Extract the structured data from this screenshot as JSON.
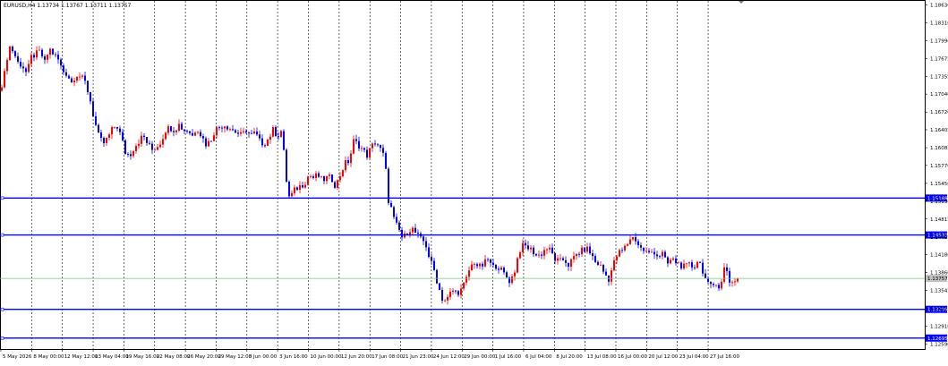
{
  "header": {
    "symbol_line": "EURUSD,H4  1.13734 1.13767 1.13711 1.13757"
  },
  "colors": {
    "background": "#ffffff",
    "bull": "#ff0000",
    "bear": "#0000ff",
    "grid": "#000000",
    "hline": "#0000ff",
    "current_price_line": "#7fbf7f"
  },
  "chart_data": {
    "type": "candlestick",
    "title": "EURUSD,H4",
    "ohlc_header": {
      "open": 1.13734,
      "high": 1.13767,
      "low": 1.13711,
      "close": 1.13757
    },
    "ylim": [
      1.125,
      1.187
    ],
    "grid": "vertical dashed",
    "price_ticks": [
      "1.18630",
      "1.18310",
      "1.17990",
      "1.17675",
      "1.17355",
      "1.17040",
      "1.16720",
      "1.16405",
      "1.16085",
      "1.15770",
      "1.15450",
      "1.15130",
      "1.14815",
      "1.14495",
      "1.14180",
      "1.13860",
      "1.13545",
      "1.13225",
      "1.12910",
      "1.12590"
    ],
    "time_labels": [
      "5 May 2026",
      "8 May 00:00",
      "12 May 12:00",
      "13 May 04:00",
      "19 May 16:00",
      "22 May 08:00",
      "26 May 20:00",
      "29 May 12:00",
      "3 Jun 00:00",
      "3 Jun 16:00",
      "10 Jun 00:00",
      "12 Jun 20:00",
      "17 Jun 08:00",
      "21 Jun 23:00",
      "24 Jun 12:00",
      "29 Jun 00:00",
      "1 Jul 16:00",
      "6 Jul 04:00",
      "8 Jul 20:00",
      "13 Jul 08:00",
      "16 Jul 00:00",
      "20 Jul 12:00",
      "23 Jul 04:00",
      "27 Jul 16:00"
    ],
    "horizontal_lines": [
      {
        "label": "1.15188",
        "price": 1.15188
      },
      {
        "label": "1.14531",
        "price": 1.14531
      },
      {
        "label": "1.13206",
        "price": 1.13206
      },
      {
        "label": "1.12695",
        "price": 1.12695
      }
    ],
    "current_price": {
      "label": "1.13757",
      "price": 1.13757
    },
    "close_path": [
      [
        0,
        1.171
      ],
      [
        5,
        1.174
      ],
      [
        10,
        1.179
      ],
      [
        15,
        1.178
      ],
      [
        20,
        1.176
      ],
      [
        25,
        1.1755
      ],
      [
        30,
        1.174
      ],
      [
        35,
        1.177
      ],
      [
        40,
        1.1775
      ],
      [
        45,
        1.178
      ],
      [
        50,
        1.176
      ],
      [
        55,
        1.1785
      ],
      [
        60,
        1.1775
      ],
      [
        65,
        1.1765
      ],
      [
        70,
        1.1745
      ],
      [
        75,
        1.174
      ],
      [
        80,
        1.1725
      ],
      [
        85,
        1.174
      ],
      [
        90,
        1.1735
      ],
      [
        95,
        1.1725
      ],
      [
        100,
        1.17
      ],
      [
        105,
        1.166
      ],
      [
        110,
        1.163
      ],
      [
        115,
        1.1615
      ],
      [
        120,
        1.1625
      ],
      [
        125,
        1.164
      ],
      [
        130,
        1.165
      ],
      [
        135,
        1.163
      ],
      [
        140,
        1.16
      ],
      [
        145,
        1.1595
      ],
      [
        150,
        1.161
      ],
      [
        155,
        1.162
      ],
      [
        160,
        1.163
      ],
      [
        165,
        1.1615
      ],
      [
        170,
        1.1605
      ],
      [
        175,
        1.161
      ],
      [
        180,
        1.162
      ],
      [
        185,
        1.164
      ],
      [
        190,
        1.1645
      ],
      [
        195,
        1.164
      ],
      [
        200,
        1.165
      ],
      [
        205,
        1.164
      ],
      [
        210,
        1.164
      ],
      [
        215,
        1.163
      ],
      [
        220,
        1.1645
      ],
      [
        225,
        1.163
      ],
      [
        230,
        1.1615
      ],
      [
        235,
        1.162
      ],
      [
        240,
        1.164
      ],
      [
        245,
        1.1645
      ],
      [
        250,
        1.165
      ],
      [
        255,
        1.1645
      ],
      [
        260,
        1.164
      ],
      [
        265,
        1.1635
      ],
      [
        270,
        1.163
      ],
      [
        275,
        1.164
      ],
      [
        280,
        1.163
      ],
      [
        285,
        1.1635
      ],
      [
        290,
        1.162
      ],
      [
        295,
        1.1615
      ],
      [
        300,
        1.1625
      ],
      [
        305,
        1.164
      ],
      [
        310,
        1.163
      ],
      [
        315,
        1.164
      ],
      [
        318,
        1.158
      ],
      [
        322,
        1.152
      ],
      [
        326,
        1.1525
      ],
      [
        330,
        1.1535
      ],
      [
        335,
        1.154
      ],
      [
        340,
        1.1545
      ],
      [
        345,
        1.156
      ],
      [
        350,
        1.1555
      ],
      [
        355,
        1.156
      ],
      [
        360,
        1.155
      ],
      [
        365,
        1.1555
      ],
      [
        370,
        1.1555
      ],
      [
        375,
        1.154
      ],
      [
        380,
        1.156
      ],
      [
        385,
        1.158
      ],
      [
        390,
        1.1585
      ],
      [
        395,
        1.162
      ],
      [
        400,
        1.1615
      ],
      [
        405,
        1.1605
      ],
      [
        410,
        1.1595
      ],
      [
        415,
        1.161
      ],
      [
        420,
        1.162
      ],
      [
        425,
        1.1605
      ],
      [
        430,
        1.159
      ],
      [
        433,
        1.152
      ],
      [
        437,
        1.15
      ],
      [
        441,
        1.1475
      ],
      [
        445,
        1.1465
      ],
      [
        450,
        1.1445
      ],
      [
        455,
        1.146
      ],
      [
        460,
        1.1465
      ],
      [
        465,
        1.1455
      ],
      [
        470,
        1.1445
      ],
      [
        475,
        1.144
      ],
      [
        480,
        1.141
      ],
      [
        485,
        1.139
      ],
      [
        490,
        1.136
      ],
      [
        495,
        1.1335
      ],
      [
        500,
        1.134
      ],
      [
        505,
        1.1355
      ],
      [
        510,
        1.135
      ],
      [
        515,
        1.1355
      ],
      [
        520,
        1.137
      ],
      [
        525,
        1.1395
      ],
      [
        530,
        1.1405
      ],
      [
        535,
        1.1395
      ],
      [
        540,
        1.14
      ],
      [
        545,
        1.141
      ],
      [
        550,
        1.1395
      ],
      [
        555,
        1.14
      ],
      [
        560,
        1.139
      ],
      [
        565,
        1.138
      ],
      [
        570,
        1.137
      ],
      [
        575,
        1.139
      ],
      [
        580,
        1.1425
      ],
      [
        585,
        1.1435
      ],
      [
        590,
        1.143
      ],
      [
        595,
        1.1425
      ],
      [
        600,
        1.1415
      ],
      [
        605,
        1.142
      ],
      [
        610,
        1.143
      ],
      [
        615,
        1.1425
      ],
      [
        620,
        1.141
      ],
      [
        625,
        1.1405
      ],
      [
        630,
        1.141
      ],
      [
        635,
        1.14
      ],
      [
        640,
        1.141
      ],
      [
        645,
        1.142
      ],
      [
        650,
        1.1425
      ],
      [
        655,
        1.143
      ],
      [
        660,
        1.142
      ],
      [
        665,
        1.1405
      ],
      [
        670,
        1.14
      ],
      [
        675,
        1.1385
      ],
      [
        680,
        1.1375
      ],
      [
        685,
        1.14
      ],
      [
        690,
        1.142
      ],
      [
        695,
        1.1425
      ],
      [
        700,
        1.1435
      ],
      [
        705,
        1.145
      ],
      [
        710,
        1.1445
      ],
      [
        715,
        1.143
      ],
      [
        720,
        1.1425
      ],
      [
        725,
        1.142
      ],
      [
        730,
        1.1425
      ],
      [
        735,
        1.1415
      ],
      [
        740,
        1.142
      ],
      [
        745,
        1.14
      ],
      [
        750,
        1.141
      ],
      [
        755,
        1.1405
      ],
      [
        760,
        1.14
      ],
      [
        765,
        1.1395
      ],
      [
        770,
        1.14
      ],
      [
        775,
        1.1395
      ],
      [
        780,
        1.141
      ],
      [
        785,
        1.139
      ],
      [
        790,
        1.1365
      ],
      [
        795,
        1.136
      ],
      [
        800,
        1.137
      ],
      [
        805,
        1.1355
      ],
      [
        808,
        1.1395
      ],
      [
        812,
        1.139
      ],
      [
        816,
        1.1365
      ],
      [
        820,
        1.1372
      ],
      [
        824,
        1.1376
      ]
    ]
  }
}
